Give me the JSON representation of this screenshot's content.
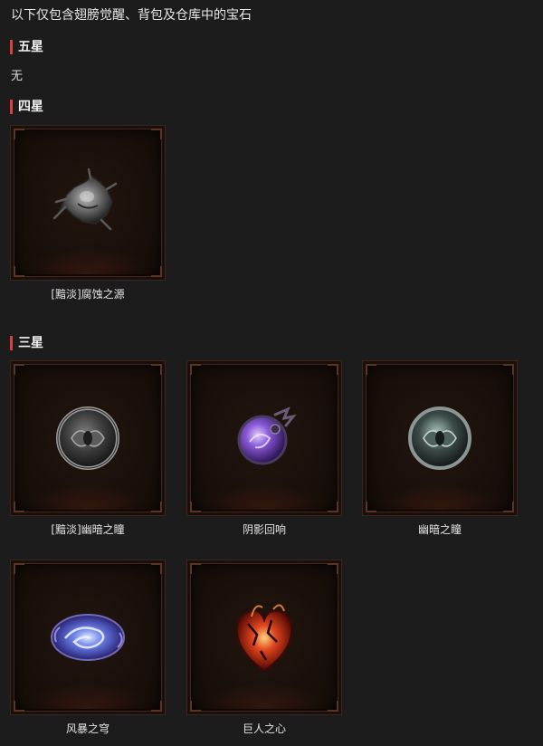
{
  "intro": "以下仅包含翅膀觉醒、背包及仓库中的宝石",
  "sections": {
    "five_star": {
      "title": "五星",
      "empty_text": "无"
    },
    "four_star": {
      "title": "四星"
    },
    "three_star": {
      "title": "三星"
    }
  },
  "gems": {
    "four_star": [
      {
        "name": "[黯淡]腐蚀之源",
        "icon": "corruption-source-gem-icon",
        "color": "#8a8a8a"
      }
    ],
    "three_star": [
      {
        "name": "[黯淡]幽暗之瞳",
        "icon": "dim-dark-eye-gem-icon",
        "color": "#9a9a9a"
      },
      {
        "name": "阴影回响",
        "icon": "shadow-echo-gem-icon",
        "color": "#8a5ad8"
      },
      {
        "name": "幽暗之瞳",
        "icon": "dark-eye-gem-icon",
        "color": "#8fa7a3"
      },
      {
        "name": "风暴之穹",
        "icon": "storm-dome-gem-icon",
        "color": "#5c6fd6"
      },
      {
        "name": "巨人之心",
        "icon": "giant-heart-gem-icon",
        "color": "#e0451e"
      }
    ]
  },
  "colors": {
    "background": "#1c1c1c",
    "section_accent": "#d9413a",
    "frame_border": "#3a261c"
  }
}
